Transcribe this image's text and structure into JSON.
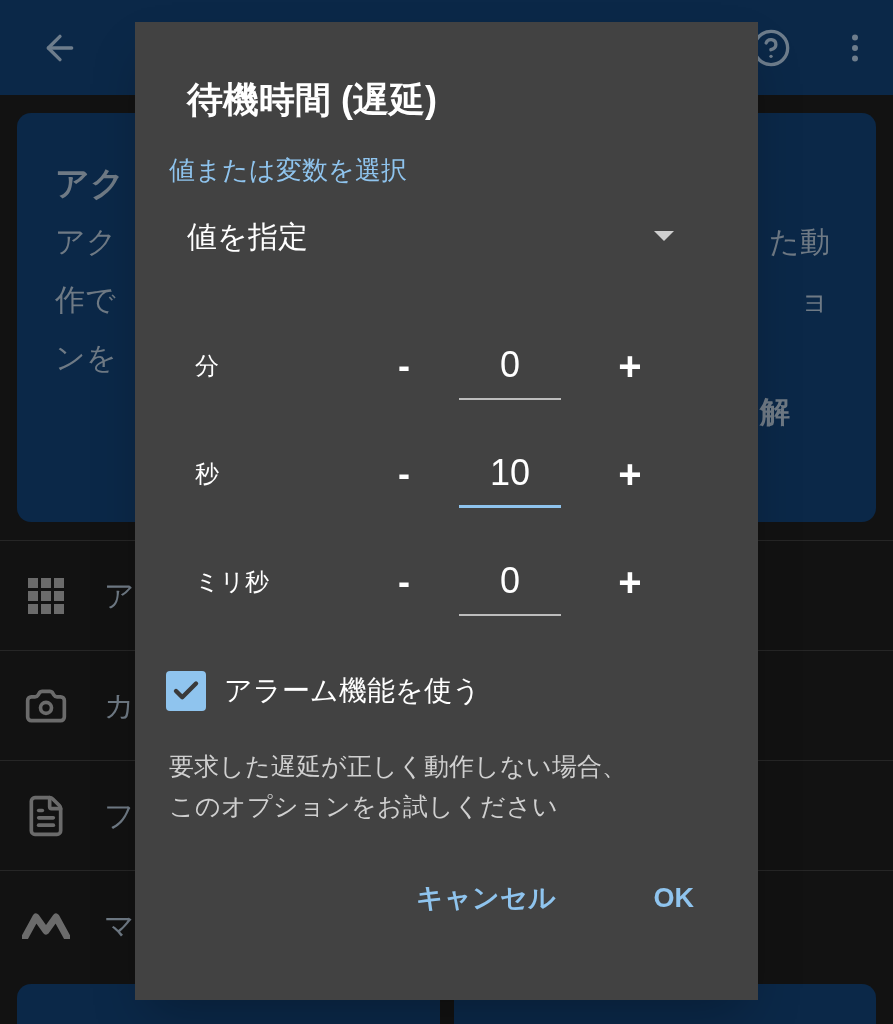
{
  "info_card": {
    "title": "アク",
    "body_left": [
      "アク",
      "作で",
      "ンを"
    ],
    "body_right": [
      "た動",
      "ョ"
    ],
    "button": "解"
  },
  "list_items": [
    "ア",
    "カ",
    "フ",
    "マ"
  ],
  "dialog": {
    "title": "待機時間 (遅延)",
    "source_label": "値または変数を選択",
    "source_value": "値を指定",
    "fields": [
      {
        "label": "分",
        "minus": "-",
        "value": "0",
        "plus": "+",
        "focused": false
      },
      {
        "label": "秒",
        "minus": "-",
        "value": "10",
        "plus": "+",
        "focused": true
      },
      {
        "label": "ミリ秒",
        "minus": "-",
        "value": "0",
        "plus": "+",
        "focused": false
      }
    ],
    "alarm": {
      "label": "アラーム機能を使う",
      "checked": true
    },
    "description": [
      "要求した遅延が正しく動作しない場合、",
      "このオプションをお試しください"
    ],
    "buttons": [
      "キャンセル",
      "OK"
    ]
  }
}
